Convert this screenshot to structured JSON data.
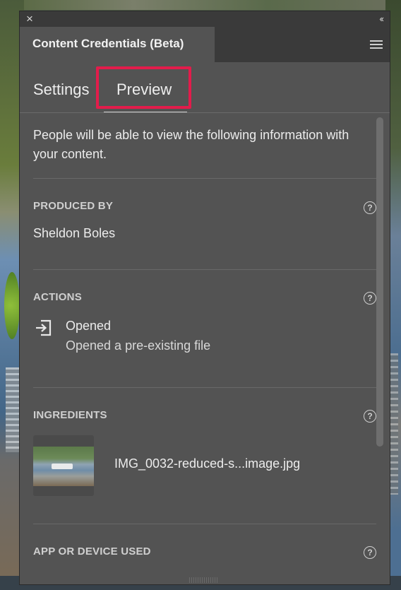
{
  "panel": {
    "close_glyph": "×",
    "collapse_glyph": "‹‹",
    "tab_title": "Content Credentials (Beta)",
    "menu_icon": "hamburger-menu-icon"
  },
  "tabs": {
    "settings": "Settings",
    "preview": "Preview",
    "active": "preview",
    "highlight_color": "#e21c4b"
  },
  "content": {
    "intro": "People will be able to view the following information with your content.",
    "produced_by": {
      "label": "PRODUCED BY",
      "value": "Sheldon Boles",
      "help": "?"
    },
    "actions": {
      "label": "ACTIONS",
      "help": "?",
      "items": [
        {
          "icon": "import-file-icon",
          "title": "Opened",
          "description": "Opened a pre-existing file"
        }
      ]
    },
    "ingredients": {
      "label": "INGREDIENTS",
      "help": "?",
      "items": [
        {
          "thumbnail": "lake-dock-photo-thumbnail",
          "name": "IMG_0032-reduced-s...image.jpg"
        }
      ]
    },
    "app_or_device": {
      "label": "APP OR DEVICE USED",
      "help": "?"
    }
  }
}
